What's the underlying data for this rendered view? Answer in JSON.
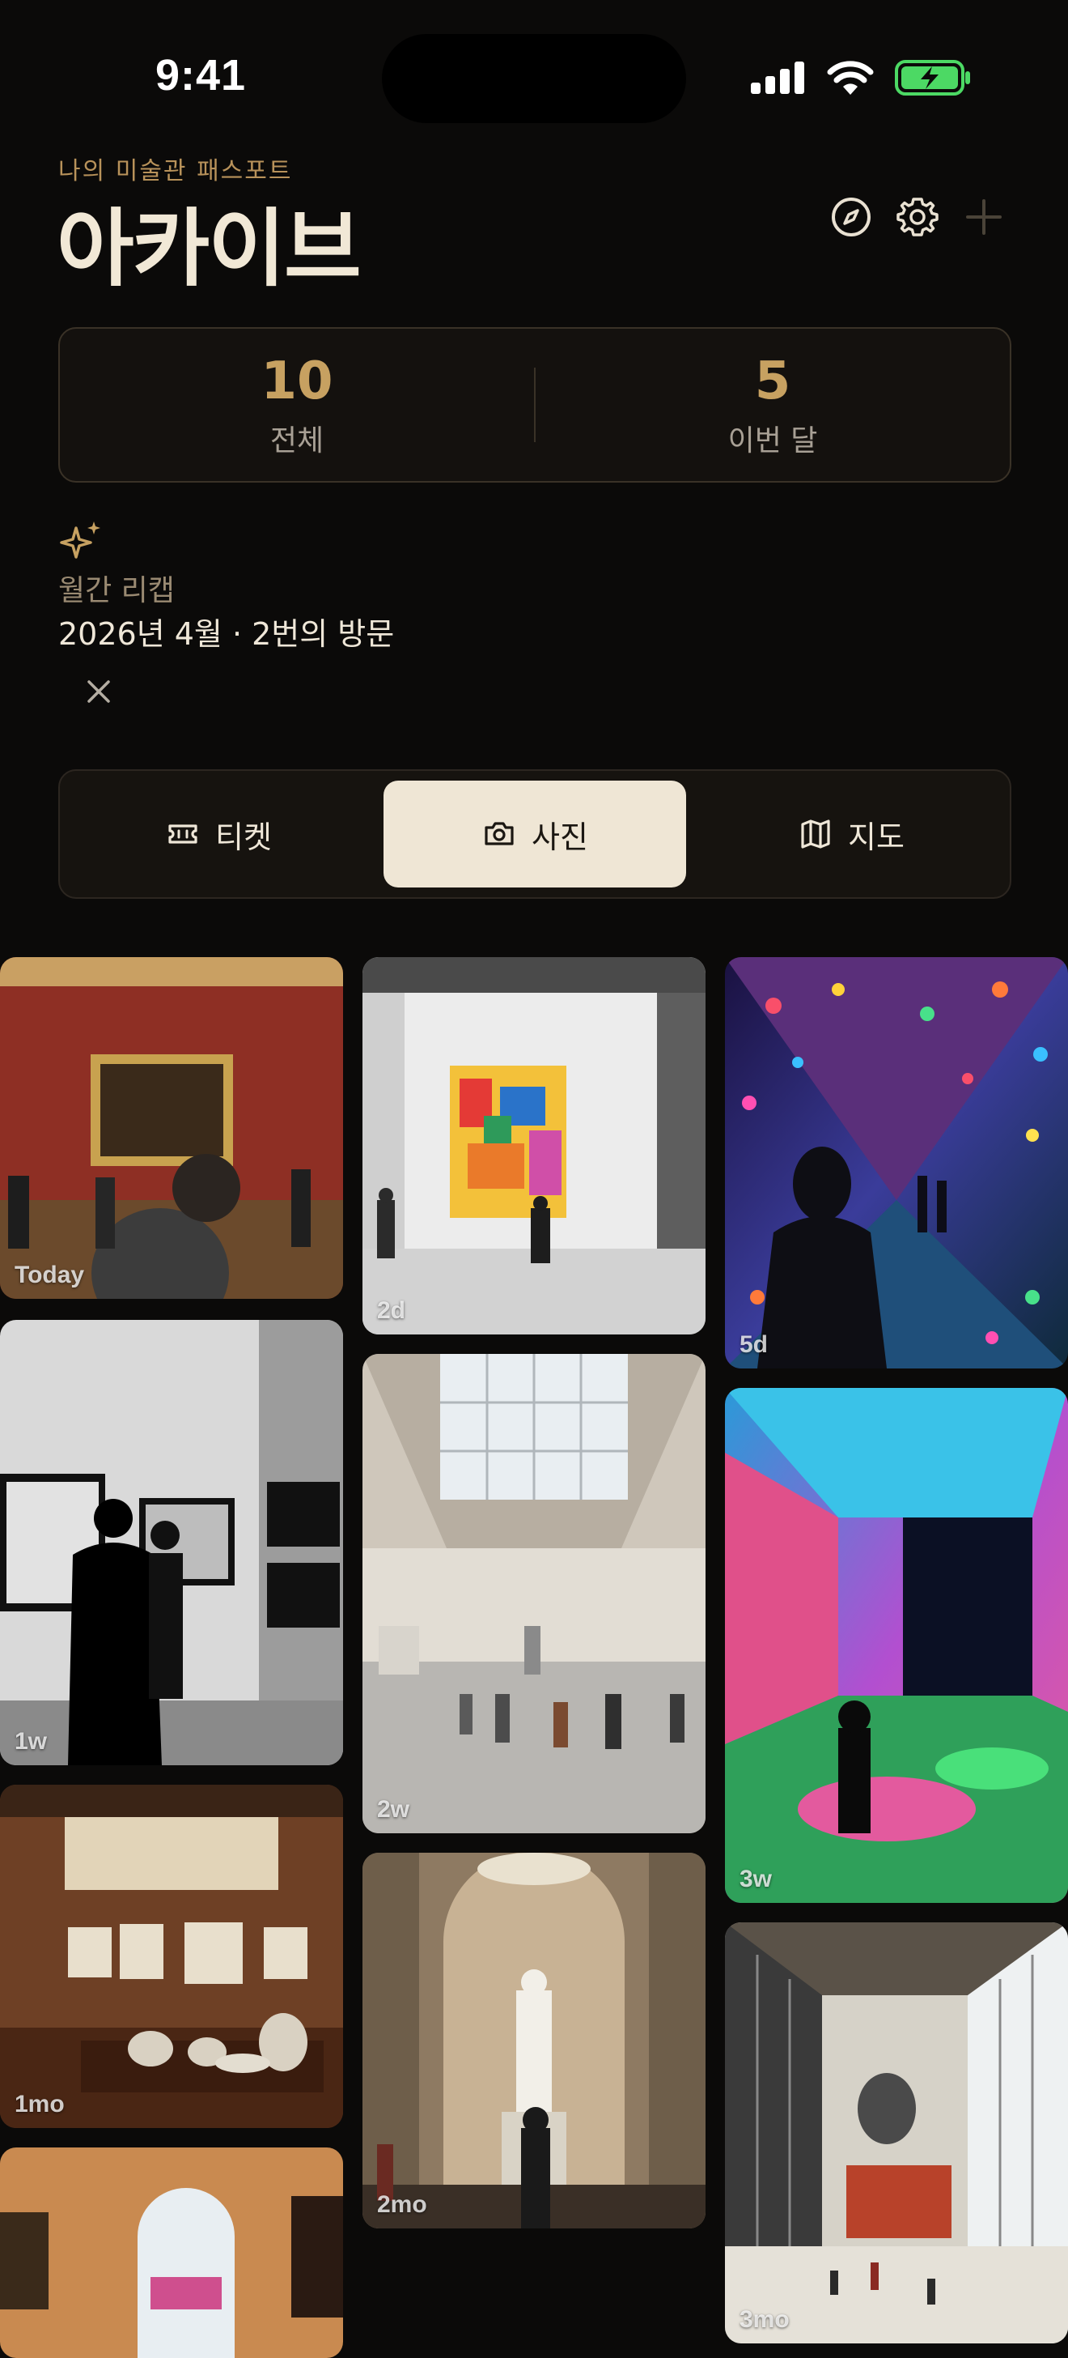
{
  "status": {
    "time": "9:41"
  },
  "header": {
    "eyebrow": "나의 미술관 패스포트",
    "title": "아카이브",
    "icons": [
      "compass-icon",
      "gear-icon",
      "plus-icon"
    ]
  },
  "stats": [
    {
      "value": "10",
      "label": "전체"
    },
    {
      "value": "5",
      "label": "이번 달"
    }
  ],
  "recap": {
    "title": "월간 리캡",
    "subtitle": "2026년 4월 · 2번의 방문"
  },
  "tabs": [
    {
      "label": "티켓",
      "icon": "ticket-icon",
      "active": false
    },
    {
      "label": "사진",
      "icon": "camera-icon",
      "active": true
    },
    {
      "label": "지도",
      "icon": "map-icon",
      "active": false
    }
  ],
  "photos": [
    {
      "badge": "Today"
    },
    {
      "badge": "2d"
    },
    {
      "badge": "5d"
    },
    {
      "badge": "1w"
    },
    {
      "badge": "2w"
    },
    {
      "badge": "3w"
    },
    {
      "badge": "1mo"
    },
    {
      "badge": "2mo"
    },
    {
      "badge": "3mo"
    },
    {
      "badge": ""
    }
  ],
  "colors": {
    "accent": "#c7a161",
    "background": "#0b0a09",
    "segment_active": "#efe6d5"
  }
}
